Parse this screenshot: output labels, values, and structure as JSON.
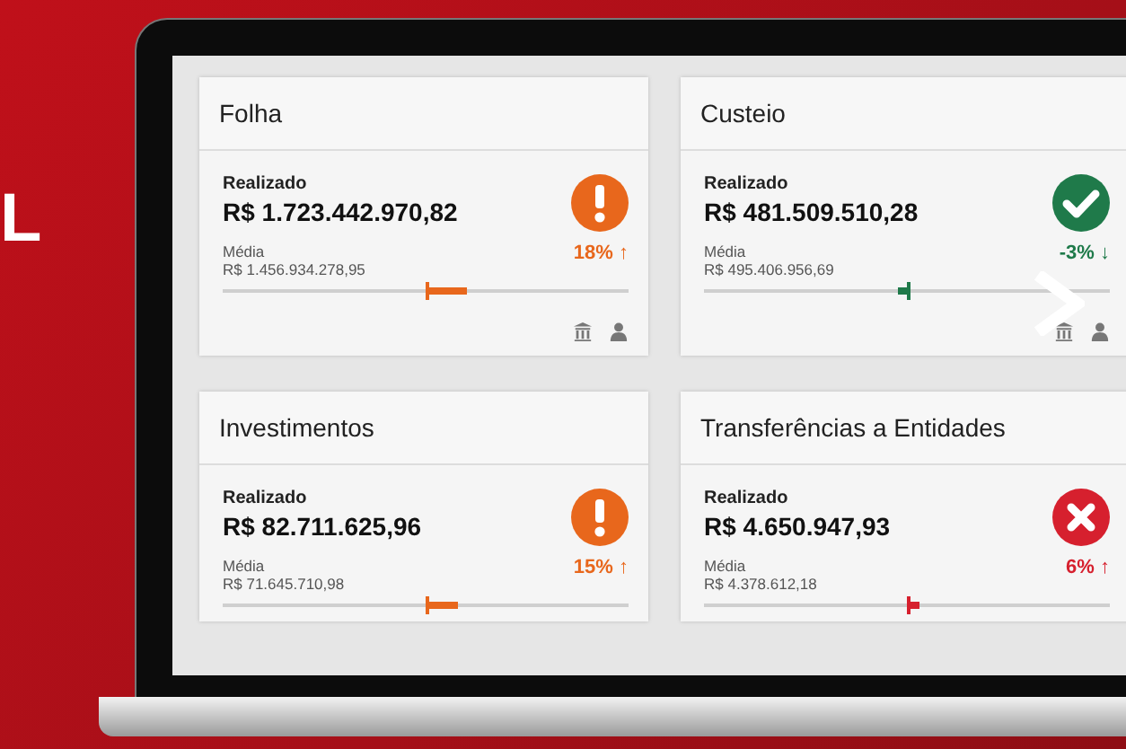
{
  "side_text": "L",
  "cards": [
    {
      "title": "Folha",
      "realized_label": "Realizado",
      "realized_value": "R$ 1.723.442.970,82",
      "kind": "warning",
      "average_label": "Média",
      "average_value": "R$ 1.456.934.278,95",
      "trend": "18% ↑",
      "level": 0.6,
      "footer_icons": true
    },
    {
      "title": "Custeio",
      "realized_label": "Realizado",
      "realized_value": "R$ 481.509.510,28",
      "kind": "ok",
      "average_label": "Média",
      "average_value": "R$ 495.406.956,69",
      "trend": "-3% ↓",
      "level": 0.48,
      "footer_icons": true
    },
    {
      "title": "Investimentos",
      "realized_label": "Realizado",
      "realized_value": "R$ 82.711.625,96",
      "kind": "warning",
      "average_label": "Média",
      "average_value": "R$ 71.645.710,98",
      "trend": "15% ↑",
      "level": 0.58,
      "footer_icons": false
    },
    {
      "title": "Transferências a Entidades",
      "realized_label": "Realizado",
      "realized_value": "R$ 4.650.947,93",
      "kind": "error",
      "average_label": "Média",
      "average_value": "R$ 4.378.612,18",
      "trend": "6% ↑",
      "level": 0.53,
      "footer_icons": false
    }
  ]
}
